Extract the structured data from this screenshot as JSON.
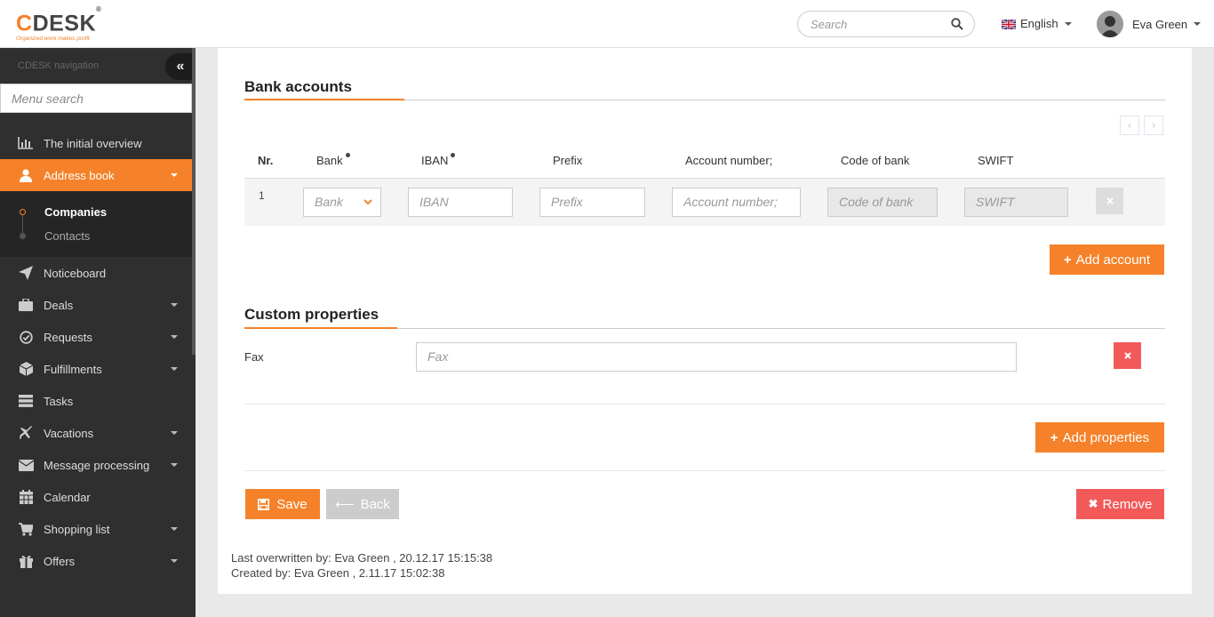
{
  "app": {
    "logo_text": "CDESK",
    "logo_tagline": "Organized work makes profit"
  },
  "topbar": {
    "search_placeholder": "Search",
    "language": "English",
    "user_name": "Eva Green"
  },
  "sidebar": {
    "nav_title": "CDESK navigation",
    "menu_search_placeholder": "Menu search",
    "items": [
      {
        "label": "The initial overview",
        "icon": "bar-chart-icon",
        "dropdown": false
      },
      {
        "label": "Address book",
        "icon": "user-icon",
        "dropdown": true,
        "active": true
      },
      {
        "label": "Noticeboard",
        "icon": "paper-plane-icon",
        "dropdown": false
      },
      {
        "label": "Deals",
        "icon": "briefcase-icon",
        "dropdown": true
      },
      {
        "label": "Requests",
        "icon": "check-circle-icon",
        "dropdown": true
      },
      {
        "label": "Fulfillments",
        "icon": "cube-icon",
        "dropdown": true
      },
      {
        "label": "Tasks",
        "icon": "tasks-icon",
        "dropdown": false
      },
      {
        "label": "Vacations",
        "icon": "plane-icon",
        "dropdown": true
      },
      {
        "label": "Message processing",
        "icon": "envelope-icon",
        "dropdown": true
      },
      {
        "label": "Calendar",
        "icon": "calendar-icon",
        "dropdown": false
      },
      {
        "label": "Shopping list",
        "icon": "cart-icon",
        "dropdown": true
      },
      {
        "label": "Offers",
        "icon": "gift-icon",
        "dropdown": true
      }
    ],
    "subitems": [
      {
        "label": "Companies",
        "active": true
      },
      {
        "label": "Contacts",
        "active": false
      }
    ]
  },
  "bank": {
    "title": "Bank accounts",
    "columns": [
      "Nr.",
      "Bank",
      "IBAN",
      "Prefix",
      "Account number;",
      "Code of bank",
      "SWIFT"
    ],
    "row": {
      "nr": "1",
      "bank_placeholder": "Bank",
      "iban_placeholder": "IBAN",
      "prefix_placeholder": "Prefix",
      "account_placeholder": "Account number;",
      "code_placeholder": "Code of bank",
      "swift_placeholder": "SWIFT"
    },
    "add_label": "Add account"
  },
  "custom": {
    "title": "Custom properties",
    "fax_label": "Fax",
    "fax_placeholder": "Fax",
    "add_label": "Add properties"
  },
  "actions": {
    "save": "Save",
    "back": "Back",
    "remove": "Remove"
  },
  "meta": {
    "overwritten": "Last overwritten by: Eva Green , 20.12.17 15:15:38",
    "created": "Created by: Eva Green , 2.11.17 15:02:38"
  },
  "colors": {
    "accent": "#f5822a",
    "danger": "#f25a5a",
    "sidebar": "#2f2f2f"
  }
}
